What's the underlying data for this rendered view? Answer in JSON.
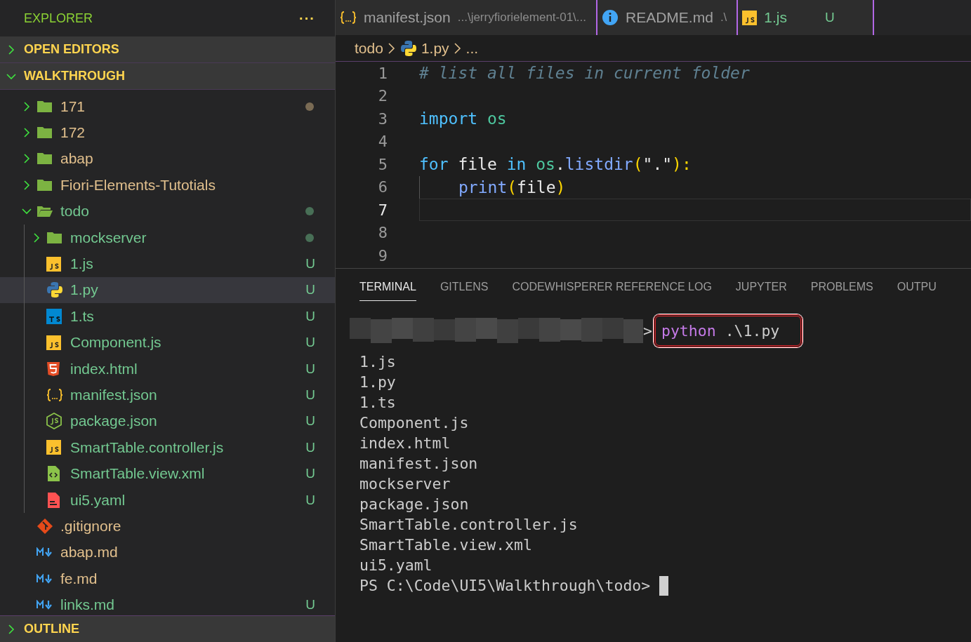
{
  "sidebar": {
    "title": "EXPLORER",
    "more": "···",
    "sections_top": [
      {
        "label": "OPEN EDITORS",
        "expanded": false
      },
      {
        "label": "WALKTHROUGH",
        "expanded": true
      }
    ],
    "tree": [
      {
        "name": "171",
        "kind": "folder",
        "expanded": false,
        "color": "#e2c08d",
        "dot": true,
        "selected": false
      },
      {
        "name": "172",
        "kind": "folder",
        "expanded": false,
        "color": "#e2c08d",
        "selected": false
      },
      {
        "name": "abap",
        "kind": "folder",
        "expanded": false,
        "color": "#e2c08d",
        "selected": false
      },
      {
        "name": "Fiori-Elements-Tutotials",
        "kind": "folder",
        "expanded": false,
        "color": "#e2c08d",
        "selected": false
      },
      {
        "name": "todo",
        "kind": "folder",
        "expanded": true,
        "color": "#73c991",
        "dot": true,
        "selected": false,
        "children": [
          {
            "name": "mockserver",
            "kind": "folder",
            "expanded": false,
            "color": "#73c991",
            "dot": true,
            "selected": false
          },
          {
            "name": "1.js",
            "kind": "js",
            "color": "#73c991",
            "badge": "U",
            "selected": false
          },
          {
            "name": "1.py",
            "kind": "py",
            "color": "#73c991",
            "badge": "U",
            "selected": true
          },
          {
            "name": "1.ts",
            "kind": "ts",
            "color": "#73c991",
            "badge": "U",
            "selected": false
          },
          {
            "name": "Component.js",
            "kind": "js",
            "color": "#73c991",
            "badge": "U",
            "selected": false
          },
          {
            "name": "index.html",
            "kind": "html",
            "color": "#73c991",
            "badge": "U",
            "selected": false
          },
          {
            "name": "manifest.json",
            "kind": "json",
            "color": "#73c991",
            "badge": "U",
            "selected": false
          },
          {
            "name": "package.json",
            "kind": "node",
            "color": "#73c991",
            "badge": "U",
            "selected": false
          },
          {
            "name": "SmartTable.controller.js",
            "kind": "js",
            "color": "#73c991",
            "badge": "U",
            "selected": false
          },
          {
            "name": "SmartTable.view.xml",
            "kind": "xml",
            "color": "#73c991",
            "badge": "U",
            "selected": false
          },
          {
            "name": "ui5.yaml",
            "kind": "yaml",
            "color": "#73c991",
            "badge": "U",
            "selected": false
          }
        ]
      },
      {
        "name": ".gitignore",
        "kind": "git",
        "color": "#e2c08d",
        "selected": false
      },
      {
        "name": "abap.md",
        "kind": "md",
        "color": "#e2c08d",
        "selected": false
      },
      {
        "name": "fe.md",
        "kind": "md",
        "color": "#e2c08d",
        "selected": false
      },
      {
        "name": "links.md",
        "kind": "md",
        "color": "#73c991",
        "badge": "U",
        "selected": false
      }
    ],
    "sections_bottom": [
      {
        "label": "OUTLINE",
        "expanded": false
      }
    ]
  },
  "editor": {
    "tabs": [
      {
        "label": "manifest.json",
        "kind": "json",
        "description": "...\\jerryfiorielement-01\\...",
        "color": "#a0a0a0"
      },
      {
        "label": "README.md",
        "kind": "info",
        "description": ".\\",
        "color": "#a0a0a0"
      },
      {
        "label": "1.js",
        "kind": "js",
        "badge": "U",
        "color": "#73c991"
      }
    ],
    "breadcrumb": [
      {
        "label": "todo"
      },
      {
        "label": "1.py",
        "kind": "py"
      },
      {
        "label": "..."
      }
    ],
    "lines": [
      {
        "number": "1",
        "current": false,
        "tokens": [
          {
            "t": "# list all files in current folder",
            "kind": "comment"
          }
        ]
      },
      {
        "number": "2",
        "current": false
      },
      {
        "number": "3",
        "current": false,
        "tokens": [
          {
            "t": "import",
            "kind": "keyword"
          },
          {
            "t": " os",
            "kind": "module"
          }
        ]
      },
      {
        "number": "4",
        "current": false
      },
      {
        "number": "5",
        "current": false,
        "tokens": [
          {
            "t": "for",
            "kind": "keyword"
          },
          {
            "t": " file ",
            "kind": "plain"
          },
          {
            "t": "in",
            "kind": "keyword"
          },
          {
            "t": " os",
            "kind": "module"
          },
          {
            "t": ".",
            "kind": "plain"
          },
          {
            "t": "listdir",
            "kind": "func"
          },
          {
            "t": "(",
            "kind": "paren"
          },
          {
            "t": "\".\"",
            "kind": "string"
          },
          {
            "t": "):",
            "kind": "paren"
          }
        ]
      },
      {
        "number": "6",
        "current": false,
        "indented": true,
        "tokens": [
          {
            "t": "print",
            "kind": "func"
          },
          {
            "t": "(",
            "kind": "paren"
          },
          {
            "t": "file",
            "kind": "plain"
          },
          {
            "t": ")",
            "kind": "paren"
          }
        ]
      },
      {
        "number": "7",
        "current": true
      },
      {
        "number": "8",
        "current": false
      },
      {
        "number": "9",
        "current": false
      }
    ]
  },
  "panel": {
    "tabs": [
      {
        "label": "TERMINAL",
        "selected": true
      },
      {
        "label": "GITLENS",
        "selected": false
      },
      {
        "label": "CODEWHISPERER REFERENCE LOG",
        "selected": false
      },
      {
        "label": "JUPYTER",
        "selected": false
      },
      {
        "label": "PROBLEMS",
        "selected": false
      },
      {
        "label": "OUTPU",
        "selected": false
      }
    ],
    "terminal": {
      "prompt_end": ">",
      "command": "python",
      "argument": ".\\1.py",
      "output": [
        "1.js",
        "1.py",
        "1.ts",
        "Component.js",
        "index.html",
        "manifest.json",
        "mockserver",
        "package.json",
        "SmartTable.controller.js",
        "SmartTable.view.xml",
        "ui5.yaml"
      ],
      "prompt": "PS C:\\Code\\UI5\\Walkthrough\\todo>"
    }
  }
}
